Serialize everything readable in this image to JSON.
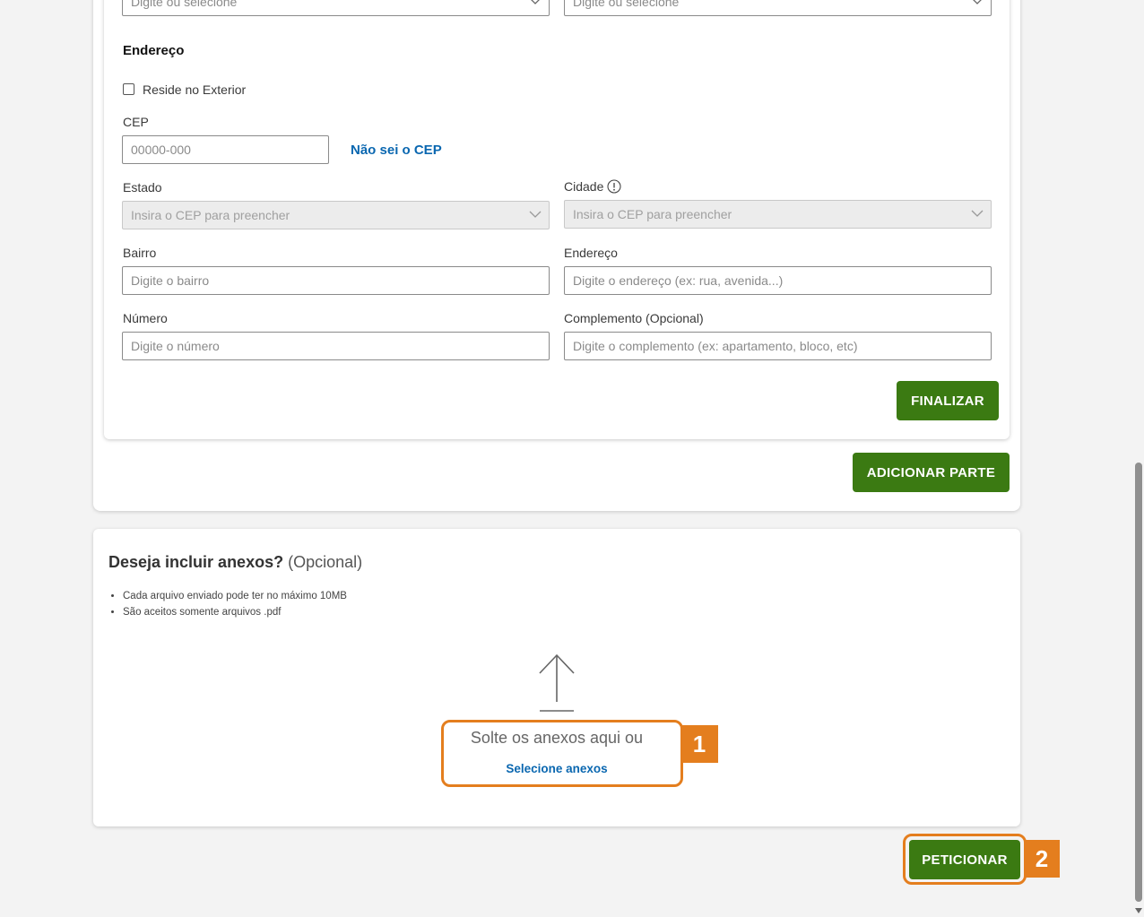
{
  "top_fields": {
    "left_placeholder": "Digite ou selecione",
    "right_placeholder": "Digite ou selecione"
  },
  "address": {
    "title": "Endereço",
    "abroad_label": "Reside no Exterior",
    "cep_label": "CEP",
    "cep_placeholder": "00000-000",
    "cep_link": "Não sei o CEP",
    "estado_label": "Estado",
    "estado_placeholder": "Insira o CEP para preencher",
    "cidade_label": "Cidade",
    "cidade_placeholder": "Insira o CEP para preencher",
    "bairro_label": "Bairro",
    "bairro_placeholder": "Digite o bairro",
    "endereco_label": "Endereço",
    "endereco_placeholder": "Digite o endereço (ex: rua, avenida...)",
    "numero_label": "Número",
    "numero_placeholder": "Digite o número",
    "complemento_label": "Complemento (Opcional)",
    "complemento_placeholder": "Digite o complemento (ex: apartamento, bloco, etc)",
    "finalizar_label": "FINALIZAR"
  },
  "parties": {
    "add_party_label": "ADICIONAR PARTE"
  },
  "attachments": {
    "title": "Deseja incluir anexos?",
    "title_optional": "(Opcional)",
    "rules": [
      "Cada arquivo enviado pode ter no máximo 10MB",
      "São aceitos somente arquivos .pdf"
    ],
    "drop_text": "Solte os anexos aqui ou",
    "select_link": "Selecione anexos"
  },
  "submit": {
    "label": "PETICIONAR"
  },
  "annotations": {
    "step1": "1",
    "step2": "2"
  },
  "colors": {
    "primary_button": "#3b7a12",
    "link": "#0a67b0",
    "annotation": "#e47e1e"
  }
}
